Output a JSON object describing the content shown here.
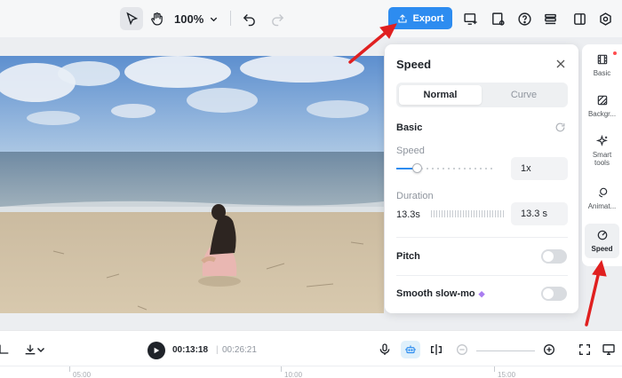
{
  "toolbar": {
    "zoom_level": "100%",
    "export_label": "Export"
  },
  "speed_panel": {
    "title": "Speed",
    "tabs": [
      {
        "label": "Normal",
        "selected": true
      },
      {
        "label": "Curve",
        "selected": false
      }
    ],
    "basic_label": "Basic",
    "speed_label": "Speed",
    "speed_value": "1x",
    "duration_label": "Duration",
    "duration_original": "13.3s",
    "duration_value": "13.3 s",
    "pitch_label": "Pitch",
    "pitch_enabled": false,
    "smooth_label": "Smooth slow-mo",
    "smooth_enabled": false
  },
  "right_rail": {
    "items": [
      {
        "label": "Basic",
        "icon": "film-icon",
        "has_badge": true
      },
      {
        "label": "Backgr...",
        "icon": "background-icon"
      },
      {
        "label": "Smart tools",
        "icon": "sparkle-icon"
      },
      {
        "label": "Animat...",
        "icon": "animation-icon"
      },
      {
        "label": "Speed",
        "icon": "speed-icon",
        "active": true
      }
    ]
  },
  "playback": {
    "current_time": "00:13:18",
    "separator": "|",
    "total_time": "00:26:21"
  },
  "ruler": {
    "labels": [
      "05:00",
      "10:00",
      "15:00"
    ]
  },
  "colors": {
    "accent": "#2d8cf0",
    "annotation_arrow": "#e02020"
  }
}
